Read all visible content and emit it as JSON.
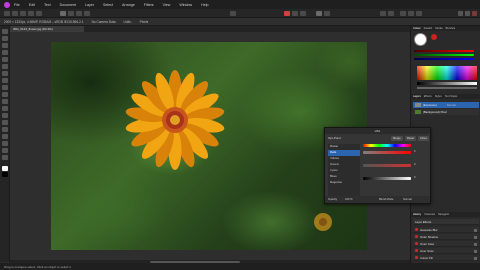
{
  "menubar": {
    "items": [
      "File",
      "Edit",
      "Text",
      "Document",
      "Layer",
      "Select",
      "Arrange",
      "Filters",
      "View",
      "Window",
      "Help"
    ]
  },
  "context": {
    "items": [
      "2000 × 1333px, 4.56MP, RGBA/8 – sRGB IEC61966-2.1",
      "No Camera Data",
      "Units:",
      "Pixels"
    ]
  },
  "document": {
    "tab_label": "IMG_0123_flower.jpg (84.3%)"
  },
  "panel": {
    "top_tabs": [
      "Colour",
      "Swatch",
      "Stroke",
      "Brushes"
    ],
    "mid_tabs": [
      "Layers",
      "Effects",
      "Styles",
      "Text Styles"
    ],
    "layers": [
      {
        "name": "(Exposure)",
        "blend": "Normal"
      },
      {
        "name": "(Background) Pixel",
        "blend": ""
      }
    ],
    "fx_tabs": [
      "History",
      "Channels",
      "Navigator"
    ],
    "fx_header": "Layer Effects",
    "fx_items": [
      "Gaussian Blur",
      "Outer Shadow",
      "Outer Glow",
      "Inner Glow",
      "Colour Fill"
    ]
  },
  "dialog": {
    "title": "HSL",
    "heading": "Opt-Point",
    "buttons": [
      "Merge",
      "Reset",
      "Close"
    ],
    "list": [
      "Master",
      "Reds",
      "Yellows",
      "Greens",
      "Cyans",
      "Blues",
      "Magentas"
    ],
    "slider_values": [
      "0",
      "0",
      "0"
    ],
    "footer": {
      "opacity_label": "Opacity",
      "opacity_value": "100 %",
      "blend_label": "Blend Mode",
      "blend_value": "Normal"
    }
  },
  "status": {
    "text": "Drag to marquee select. Click an object to select it."
  },
  "colors": {
    "accent": "#2b65b0",
    "petal": "#f2a512",
    "petal_dark": "#d9820a",
    "center": "#b8441a"
  }
}
